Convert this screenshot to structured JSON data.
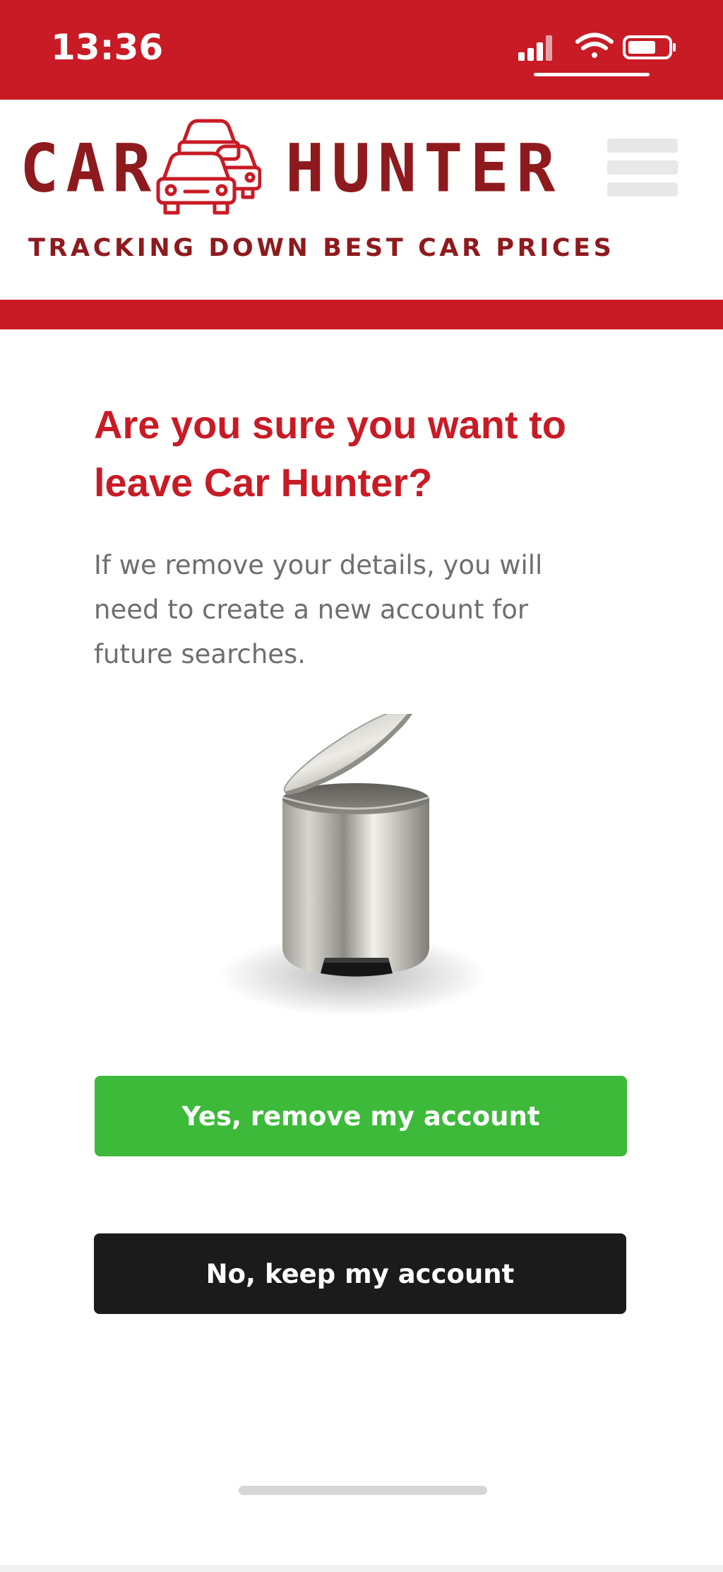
{
  "status_bar": {
    "time": "13:36",
    "icons": [
      "signal-icon",
      "wifi-icon",
      "battery-icon"
    ]
  },
  "header": {
    "logo_word_1": "CAR",
    "logo_word_2": "HUNTER",
    "logo_icon": "cars-icon",
    "tagline": "TRACKING DOWN BEST CAR PRICES",
    "menu_icon": "hamburger-menu-icon"
  },
  "main": {
    "title": "Are you sure you want to leave Car Hunter?",
    "body": "If we remove your details, you will need to create a new account for future searches.",
    "illustration": "trash-bin-icon"
  },
  "actions": {
    "confirm_label": "Yes, remove my account",
    "cancel_label": "No, keep my account"
  },
  "colors": {
    "brand_red": "#c81b25",
    "logo_dark_red": "#8e1a1e",
    "confirm_green": "#3dba3a",
    "cancel_black": "#1b1b1b",
    "body_gray": "#6e6e6e"
  }
}
